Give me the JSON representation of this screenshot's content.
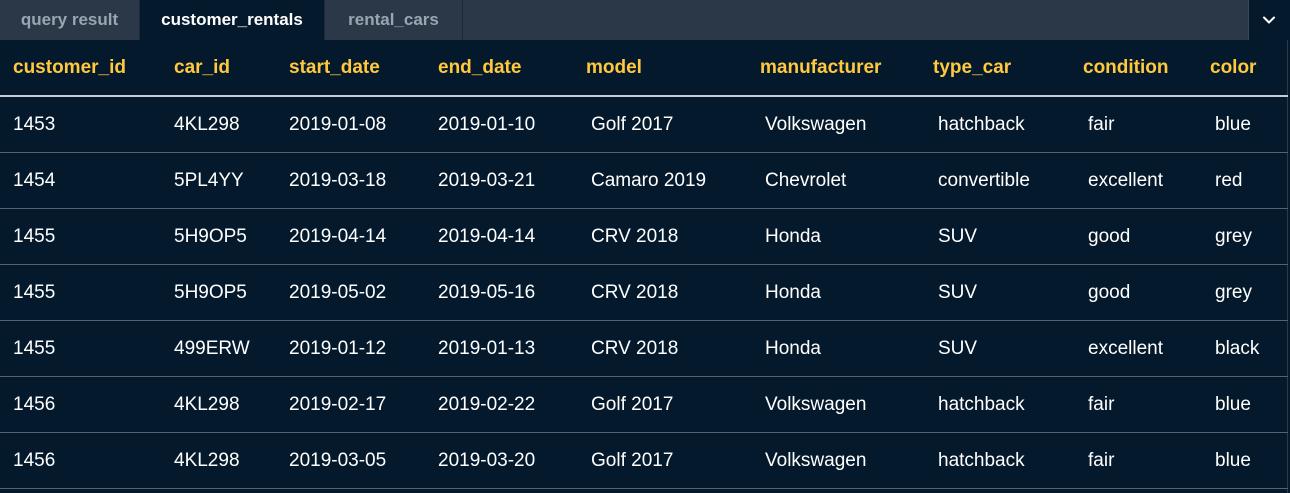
{
  "tabs": [
    {
      "label": "query result",
      "active": false
    },
    {
      "label": "customer_rentals",
      "active": true
    },
    {
      "label": "rental_cars",
      "active": false
    }
  ],
  "dropdown_icon": "chevron-down-icon",
  "table": {
    "columns": [
      "customer_id",
      "car_id",
      "start_date",
      "end_date",
      "model",
      "manufacturer",
      "type_car",
      "condition",
      "color"
    ],
    "rows": [
      [
        "1453",
        "4KL298",
        "2019-01-08",
        "2019-01-10",
        "Golf 2017",
        "Volkswagen",
        "hatchback",
        "fair",
        "blue"
      ],
      [
        "1454",
        "5PL4YY",
        "2019-03-18",
        "2019-03-21",
        "Camaro 2019",
        "Chevrolet",
        "convertible",
        "excellent",
        "red"
      ],
      [
        "1455",
        "5H9OP5",
        "2019-04-14",
        "2019-04-14",
        "CRV 2018",
        "Honda",
        "SUV",
        "good",
        "grey"
      ],
      [
        "1455",
        "5H9OP5",
        "2019-05-02",
        "2019-05-16",
        "CRV 2018",
        "Honda",
        "SUV",
        "good",
        "grey"
      ],
      [
        "1455",
        "499ERW",
        "2019-01-12",
        "2019-01-13",
        "CRV 2018",
        "Honda",
        "SUV",
        "excellent",
        "black"
      ],
      [
        "1456",
        "4KL298",
        "2019-02-17",
        "2019-02-22",
        "Golf 2017",
        "Volkswagen",
        "hatchback",
        "fair",
        "blue"
      ],
      [
        "1456",
        "4KL298",
        "2019-03-05",
        "2019-03-20",
        "Golf 2017",
        "Volkswagen",
        "hatchback",
        "fair",
        "blue"
      ]
    ]
  },
  "colors": {
    "background": "#05192d",
    "tabbar": "#2a3848",
    "header_text": "#ffc83d",
    "body_text": "#ffffff"
  }
}
